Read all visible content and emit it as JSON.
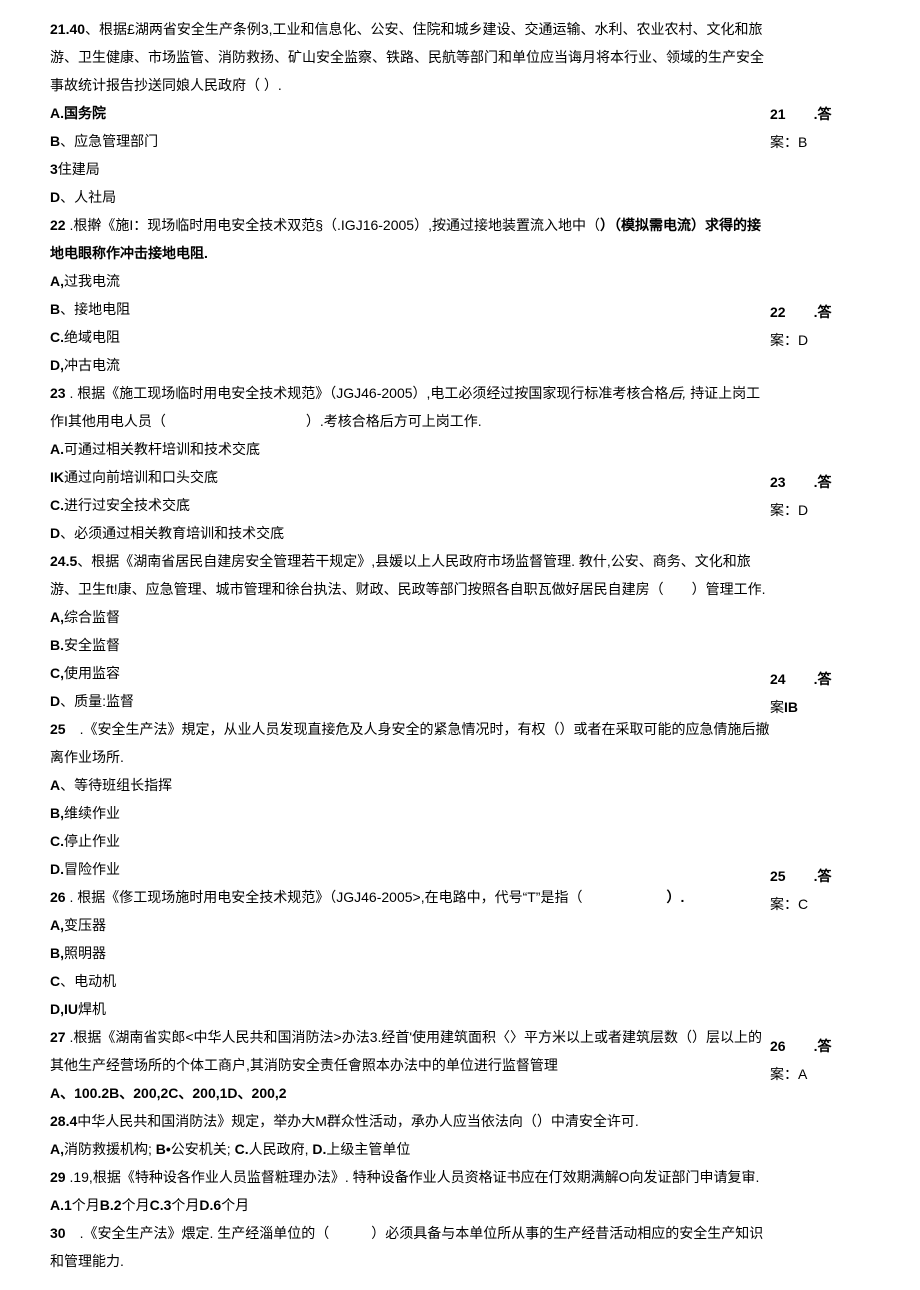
{
  "q21": {
    "num": "21.40",
    "text": "、根据£湖两省安全生产条例3,工业和信息化、公安、住院和城乡建设、交通运输、水利、农业农村、文化和旅游、卫生健康、市场监管、消防救扬、矿山安全监察、铁路、民航等部门和单位应当诲月将本行业、领域的生产安全事故统计报告抄送同娘人民政府（ ）.",
    "a": "A.国务院",
    "b": "B、应急管理部门",
    "c": "3住建局",
    "d": "D、人社局",
    "ans_num": "21",
    "ans_dot": ".答",
    "ans_text": "案：B"
  },
  "q22": {
    "num": "22",
    "text": " .根擀《施I：现场临时用电安全技术双范§（.IGJ16-2005）,按通过接地装置流入地中（",
    "text2": "）（模拟需电流）求得的接地电眼称作冲击接地电阻.",
    "a": "A,过我电流",
    "b": "B、接地电阻",
    "c": "C.绝域电阻",
    "d": "D,冲古电流",
    "ans_num": "22",
    "ans_dot": ".答",
    "ans_text": "案：D"
  },
  "q23": {
    "num": "23",
    "text": " . 根据《施工现场临时用电安全技术规范》（JGJ46-2005）,电工必须经过按国家现行标准考核合格",
    "text_i": "后,",
    "text2": "持证上岗工作I其他用电人员（",
    "text3": "）.考核合格后方可上岗工作.",
    "a": "A.可通过相关教杆培训和技术交底",
    "b": "IK通过向前培训和口头交底",
    "c": "C.进行过安全技术交底",
    "d": "D、必须通过相关教育培训和技术交底",
    "ans_num": "23",
    "ans_dot": ".答",
    "ans_text": "案：D"
  },
  "q24": {
    "num": "24.5",
    "text": "、根据《湖南省居民自建房安全管理若干规定》,县媛以上人民政府市场监督管理. 教什,公安、商务、文化和旅游、卫生ft!康、应急管理、城市管理和徐台执法、财政、民政等部门按照各自职瓦做好居民自建房（　　）管理工作.",
    "a": "A,综合监督",
    "b": "B.安全监督",
    "c": "C,使用监容",
    "d": "D、质量:监督",
    "ans_num": "24",
    "ans_dot": ".答",
    "ans_text": "案IB"
  },
  "q25": {
    "num": "25",
    "text": "　.《安全生产法》規定，从业人员发现直接危及人身安全的紧急情况时，有权（）或者在采取可能的应急倩施后撤离作业场所.",
    "a": "A、等待班组长指挥",
    "b": "B,维续作业",
    "c": "C.停止作业",
    "d": "D.冒险作业",
    "ans_num": "25",
    "ans_dot": ".答",
    "ans_text": "案：C"
  },
  "q26": {
    "num": "26",
    "text": " . 根据《俢工现场施时用电安全技术规范》（JGJ46-2005>,在电路中，代号“T”是指（",
    "text2": "）.",
    "a": "A,变压器",
    "b": "B,照明器",
    "c": "C、电动机",
    "d": "D,IU焊机",
    "ans_num": "26",
    "ans_dot": ".答",
    "ans_text": "案：A"
  },
  "q27": {
    "num": "27",
    "text": " .根据《湖南省实郎<中华人民共和国消防法>办法3.经首'使用建筑面积〈〉平方米以上或者建筑层数（）层以上的其他生产经营场所的个体工商户,其消防安全责任會照本办法中的单位进行监督管理",
    "a": "A、100.2B、200,2C、200,1D、200,2"
  },
  "q28": {
    "num": "28.4",
    "text": "中华人民共和国消防法》规定，举办大M群众性活动，承办人应当依法向（）中清安全许可.",
    "a": "A,消防救援机构; B•公安机关; C.人民政府, D.上级主管单位"
  },
  "q29": {
    "num": "29",
    "text": " .19,根据《特种设各作业人员监督粧理办法》. 特种设备作业人员资格证书应在仃效期满解O向发证部门申请复审.",
    "a": "A.1个月B.2个月C.3个月D.6个月"
  },
  "q30": {
    "num": "30",
    "text": "　.《安全生产法》煨定. 生产经淄单位的（　　　）必须具备与本单位所从事的生产经昔活动相应的安全生产知识和管理能力."
  }
}
